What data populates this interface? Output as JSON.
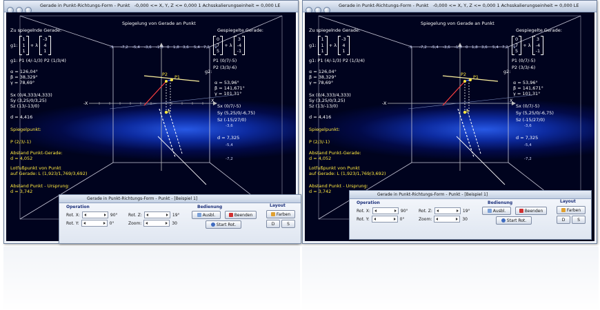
{
  "window": {
    "title": "Gerade in Punkt-Richtungs-Form - Punkt",
    "status": "-0,000 <= X, Y, Z <= 0,000    1 Achsskalierungseinheit = 0,000 LE"
  },
  "canvas": {
    "heading": "Spiegelung von Gerade an Punkt",
    "zu_spiegelnde": "Zu spiegelnde Gerade:",
    "gespiegelte": "Gespiegelte Gerade:",
    "g1_label": "g1:",
    "g1_vec_a": [
      "1",
      "1",
      "1"
    ],
    "g1_vec_b": [
      "-3",
      "4",
      "1"
    ],
    "g2_label": "g2:",
    "g2_vec_a": [
      "0",
      "7",
      "5"
    ],
    "g2_vec_b": [
      "3",
      "-4",
      "-1"
    ],
    "plus_lambda": "+ λ",
    "g1_points": "g1: P1 (4/-1/3)    P2 (1/3/4)",
    "g2_points": "P1 (0/7/-5)",
    "g2_points2": "P2 (3/3/-6)",
    "alpha1": "α = 126,04°",
    "beta1": "β = 38,329°",
    "gamma1": "γ = 78,69°",
    "alpha2": "α = 53,96°",
    "beta2": "β = 141,671°",
    "gamma2": "γ = 101,31°",
    "sx1": "Sx (0/4,333/4,333)",
    "sy1": "Sy (3,25/0/3,25)",
    "sz1": "Sz (13/-13/0)",
    "sx2": "Sx (0/7/-5)",
    "sy2": "Sy (5,25/0/-6,75)",
    "sz2": "Sz (-15/27/0)",
    "d1": "d = 4,416",
    "d2": "d = 7,325",
    "spiegelpunkt": "Spiegelpunkt:",
    "p": "P (2/3/-1)",
    "abstand_pg": "Abstand Punkt-Gerade:",
    "abstand_pg_val": "d = 4,052",
    "lotfuss": "Lotfußpunkt von Punkt",
    "lotfuss2": "auf Gerade: L (1,923/1,769/3,692)",
    "abstand_po": "Abstand Punkt - Ursprung:",
    "abstand_po_val": "d = 3,742",
    "pt_P1": "P1",
    "pt_P2": "P2",
    "pt_P": "P",
    "axis_x": "X",
    "axis_negx": "-X",
    "axis_y": "Y",
    "axis_negy": "-Y",
    "ticks_top": [
      "-9",
      "-7,2",
      "-5,4",
      "-3,6",
      "-1,8",
      "0",
      "1,8",
      "3,6",
      "5,4",
      "7,2",
      "9"
    ],
    "ticks_right": [
      "3,6",
      "5,4",
      "7,2",
      "-3,6",
      "-5,4",
      "-7,2"
    ]
  },
  "panel": {
    "title": "Gerade in Punkt-Richtungs-Form - Punkt - [Beispiel 1]",
    "operation": "Operation",
    "rot_x": "Rot. X:",
    "rot_x_val": "90°",
    "rot_y": "Rot. Y:",
    "rot_y_val": "0°",
    "rot_z": "Rot. Z:",
    "rot_z_val": "19°",
    "zoom": "Zoom:",
    "zoom_val": "30",
    "bedienung": "Bedienung",
    "ausbl": "Ausbl.",
    "beenden": "Beenden",
    "start_rot": "Start Rot.",
    "layout": "Layout",
    "farben": "Farben",
    "d_btn": "D",
    "s_btn": "S"
  },
  "colors": {
    "yellow_text": "#ffe840",
    "line_g1": "#fff3a0",
    "line_g2": "#d0e0ff",
    "vector": "#ff4040"
  }
}
